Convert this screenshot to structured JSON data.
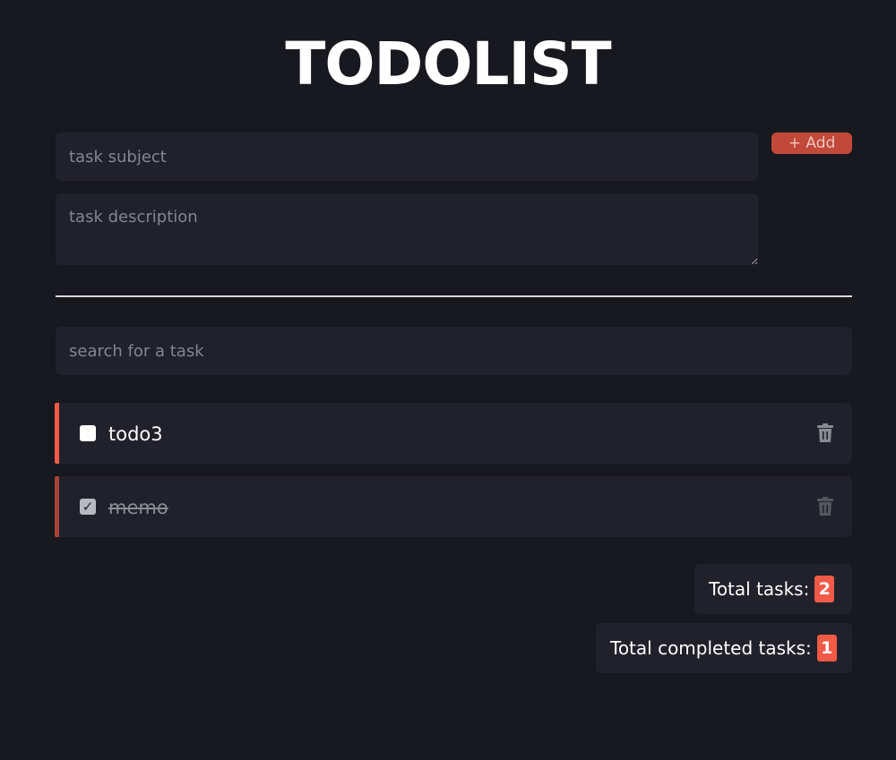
{
  "app": {
    "title": "TODOLIST"
  },
  "form": {
    "subject_placeholder": "task subject",
    "description_placeholder": "task description",
    "add_label": "+ Add"
  },
  "search": {
    "placeholder": "search for a task"
  },
  "tasks": [
    {
      "label": "todo3",
      "completed": false
    },
    {
      "label": "memo",
      "completed": true
    }
  ],
  "stats": {
    "total_label": "Total tasks:",
    "total_value": "2",
    "completed_label": "Total completed tasks:",
    "completed_value": "1"
  },
  "icons": {
    "trash": "trash-icon",
    "check": "check-icon"
  },
  "colors": {
    "background": "#18181f",
    "surface": "#21212b",
    "accent": "#f15a46",
    "accent_muted": "#a84537",
    "add_button": "#c0493a"
  }
}
